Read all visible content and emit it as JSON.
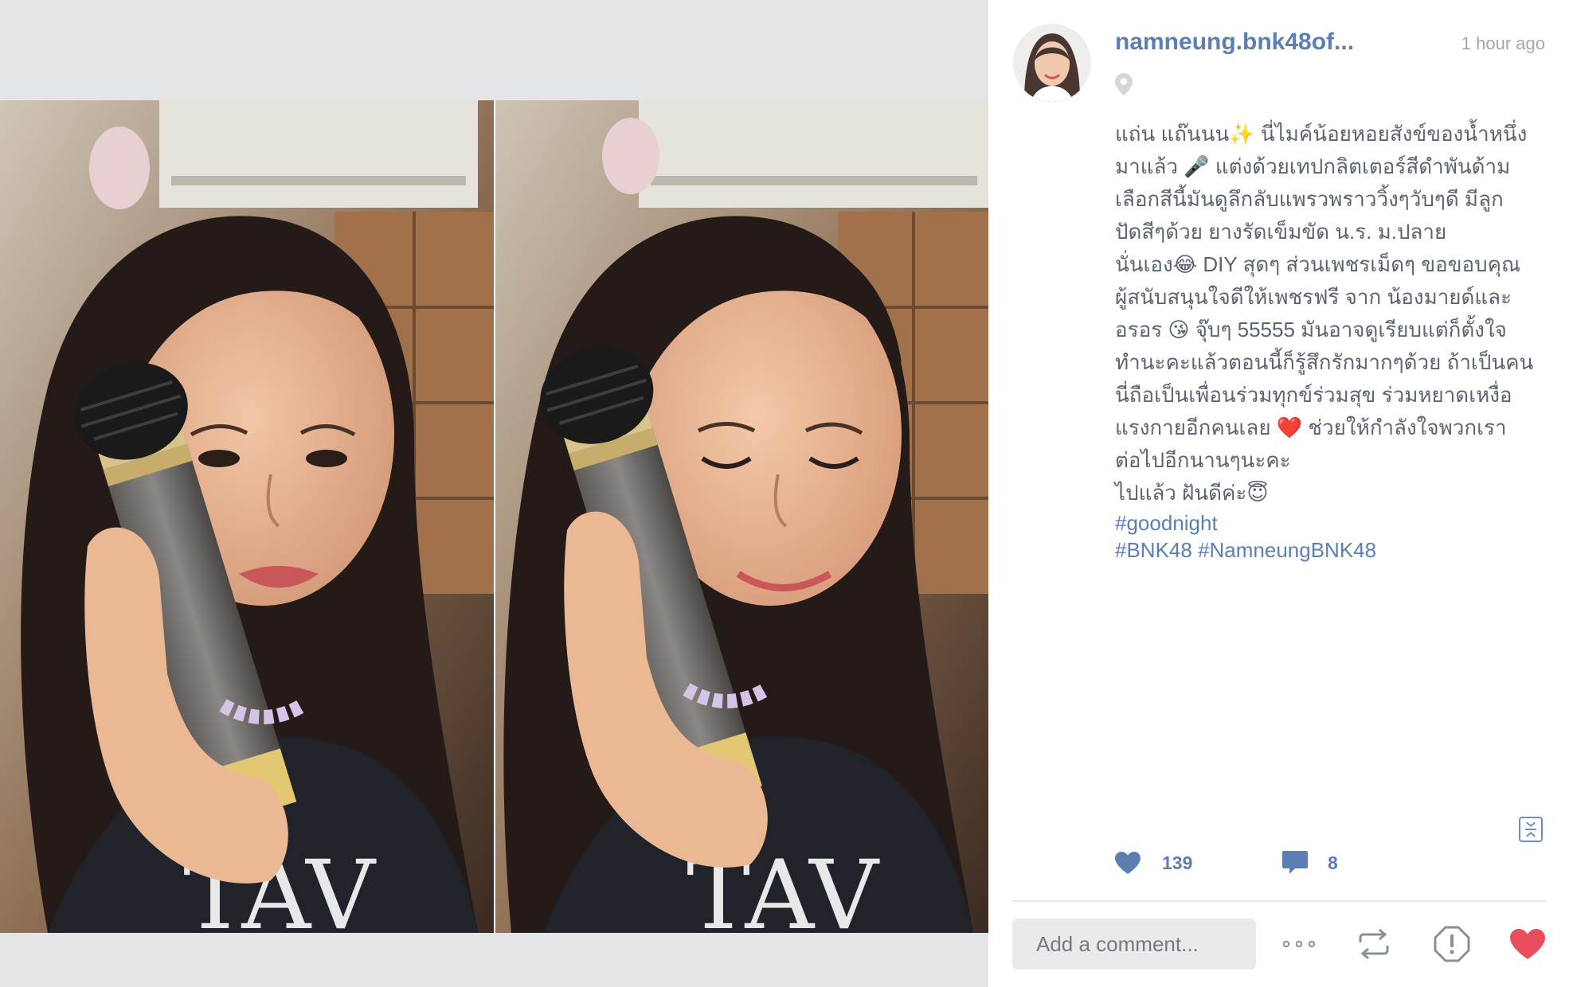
{
  "post": {
    "username": "namneung.bnk48of...",
    "time": "1 hour ago",
    "caption_lines": [
      "แถ่น แถ๊นนน✨ นี่ไมค์น้อยหอยสังข์ของน้ำหนึ่ง",
      "มาแล้ว 🎤 แต่งด้วยเทปกลิตเตอร์สีดำพันด้าม",
      "เลือกสีนี้มันดูลึกลับแพรวพราววิ้งๆวับๆดี มีลูก",
      "ปัดสีๆด้วย ยางรัดเข็มขัด น.ร. ม.ปลาย",
      "นั่นเอง😂 DIY สุดๆ ส่วนเพชรเม็ดๆ ขอขอบคุณ",
      "ผู้สนับสนุนใจดีให้เพชรฟรี จาก น้องมายด์และ",
      "อรอร 😘 จุ๊บๆ 55555 มันอาจดูเรียบแต่ก็ตั้งใจ",
      "ทำนะคะแล้วตอนนี้ก็รู้สึกรักมากๆด้วย ถ้าเป็นคน",
      "นี่ถือเป็นเพื่อนร่วมทุกข์ร่วมสุข ร่วมหยาดเหงื่อ",
      "แรงกายอีกคนเลย ❤️ ช่วยให้กำลังใจพวกเรา",
      "ต่อไปอีกนานๆนะคะ",
      "ไปแล้ว ฝันดีค่ะ😇"
    ],
    "hashtags_line1": "#goodnight",
    "hashtags_line2": "#BNK48 #NamneungBNK48",
    "likes": "139",
    "comments": "8"
  },
  "comment_box": {
    "placeholder": "Add a comment..."
  },
  "icons": {
    "location": "location-pin-icon",
    "collapse": "collapse-icon",
    "like": "heart-icon",
    "comment": "speech-bubble-icon",
    "more": "ellipsis-icon",
    "repost": "repost-icon",
    "report": "report-icon",
    "favorite": "heart-filled-icon"
  },
  "colors": {
    "link_blue": "#5b7fb3",
    "text_gray": "#5b6470",
    "heart_red": "#ea4d5b",
    "muted_gray": "#a3a8ae"
  }
}
